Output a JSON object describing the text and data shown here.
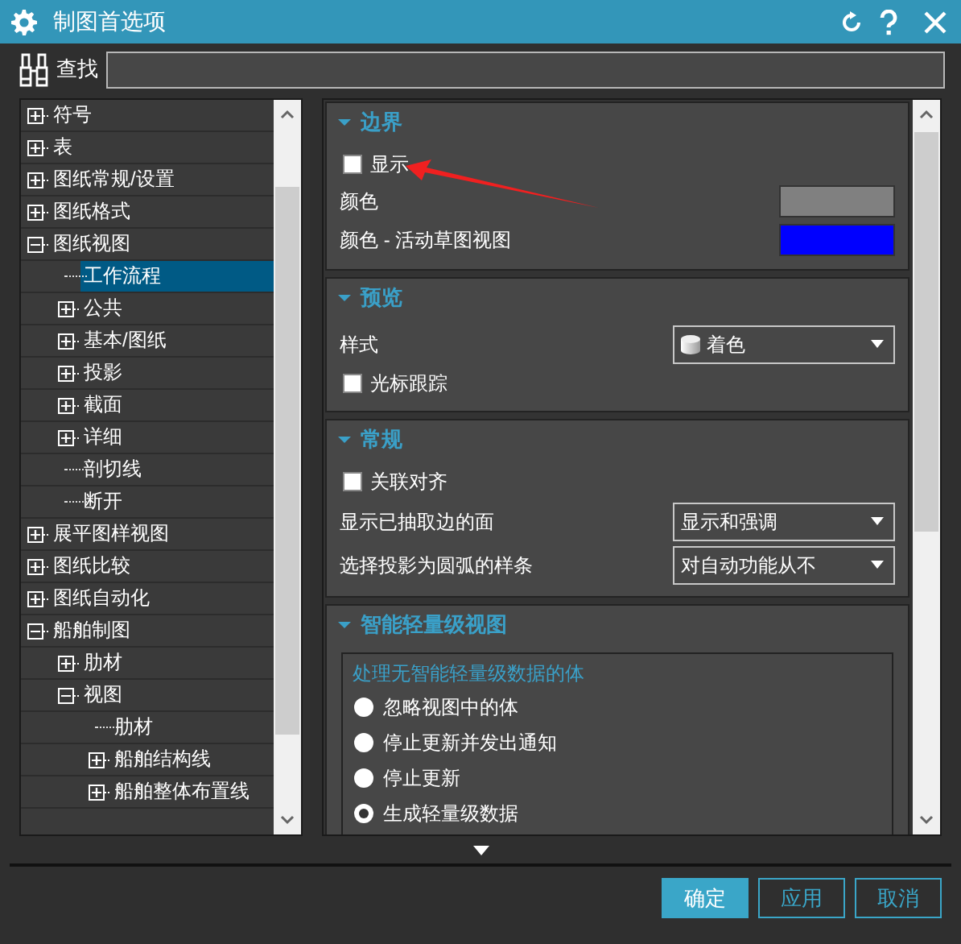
{
  "window": {
    "title": "制图首选项"
  },
  "search": {
    "label": "查找"
  },
  "tree": [
    {
      "label": "符号",
      "kind": "node",
      "expanded": false,
      "selected": false
    },
    {
      "label": "表",
      "kind": "node",
      "expanded": false,
      "selected": false
    },
    {
      "label": "图纸常规/设置",
      "kind": "node",
      "expanded": false,
      "selected": false
    },
    {
      "label": "图纸格式",
      "kind": "node",
      "expanded": false,
      "selected": false
    },
    {
      "label": "图纸视图",
      "kind": "node",
      "expanded": true,
      "selected": false,
      "children": [
        {
          "label": "工作流程",
          "kind": "leaf",
          "selected": true
        },
        {
          "label": "公共",
          "kind": "node",
          "expanded": false,
          "selected": false
        },
        {
          "label": "基本/图纸",
          "kind": "node",
          "expanded": false,
          "selected": false
        },
        {
          "label": "投影",
          "kind": "node",
          "expanded": false,
          "selected": false
        },
        {
          "label": "截面",
          "kind": "node",
          "expanded": false,
          "selected": false
        },
        {
          "label": "详细",
          "kind": "node",
          "expanded": false,
          "selected": false
        },
        {
          "label": "剖切线",
          "kind": "leaf",
          "selected": false
        },
        {
          "label": "断开",
          "kind": "leaf",
          "selected": false
        }
      ]
    },
    {
      "label": "展平图样视图",
      "kind": "node",
      "expanded": false,
      "selected": false
    },
    {
      "label": "图纸比较",
      "kind": "node",
      "expanded": false,
      "selected": false
    },
    {
      "label": "图纸自动化",
      "kind": "node",
      "expanded": false,
      "selected": false
    },
    {
      "label": "船舶制图",
      "kind": "node",
      "expanded": true,
      "selected": false,
      "children": [
        {
          "label": "肋材",
          "kind": "node",
          "expanded": false,
          "selected": false
        },
        {
          "label": "视图",
          "kind": "node",
          "expanded": true,
          "selected": false,
          "children": [
            {
              "label": "肋材",
              "kind": "leaf",
              "selected": false
            },
            {
              "label": "船舶结构线",
              "kind": "node",
              "expanded": false,
              "selected": false
            },
            {
              "label": "船舶整体布置线",
              "kind": "node",
              "expanded": false,
              "selected": false
            }
          ]
        }
      ]
    }
  ],
  "sections": [
    {
      "title": "边界",
      "expanded": true,
      "items": [
        {
          "kind": "checkbox",
          "label": "显示",
          "checked": false
        },
        {
          "kind": "color",
          "label": "颜色",
          "color": "#808080"
        },
        {
          "kind": "color",
          "label": "颜色 - 活动草图视图",
          "color": "#0000ff"
        }
      ]
    },
    {
      "title": "预览",
      "expanded": true,
      "items": [
        {
          "kind": "shadedropdown",
          "label": "样式",
          "value": "着色"
        },
        {
          "kind": "checkbox",
          "label": "光标跟踪",
          "checked": false
        }
      ]
    },
    {
      "title": "常规",
      "expanded": true,
      "items": [
        {
          "kind": "checkbox",
          "label": "关联对齐",
          "checked": false
        },
        {
          "kind": "dropdown",
          "label": "显示已抽取边的面",
          "value": "显示和强调"
        },
        {
          "kind": "dropdown",
          "label": "选择投影为圆弧的样条",
          "value": "对自动功能从不"
        }
      ]
    },
    {
      "title": "智能轻量级视图",
      "expanded": true,
      "group": {
        "title": "处理无智能轻量级数据的体",
        "options": [
          {
            "label": "忽略视图中的体",
            "selected": false
          },
          {
            "label": "停止更新并发出通知",
            "selected": false
          },
          {
            "label": "停止更新",
            "selected": false
          },
          {
            "label": "生成轻量级数据",
            "selected": true
          }
        ]
      }
    }
  ],
  "buttons": [
    {
      "label": "确定",
      "kind": "primary"
    },
    {
      "label": "应用",
      "kind": "secondary"
    },
    {
      "label": "取消",
      "kind": "secondary"
    }
  ]
}
